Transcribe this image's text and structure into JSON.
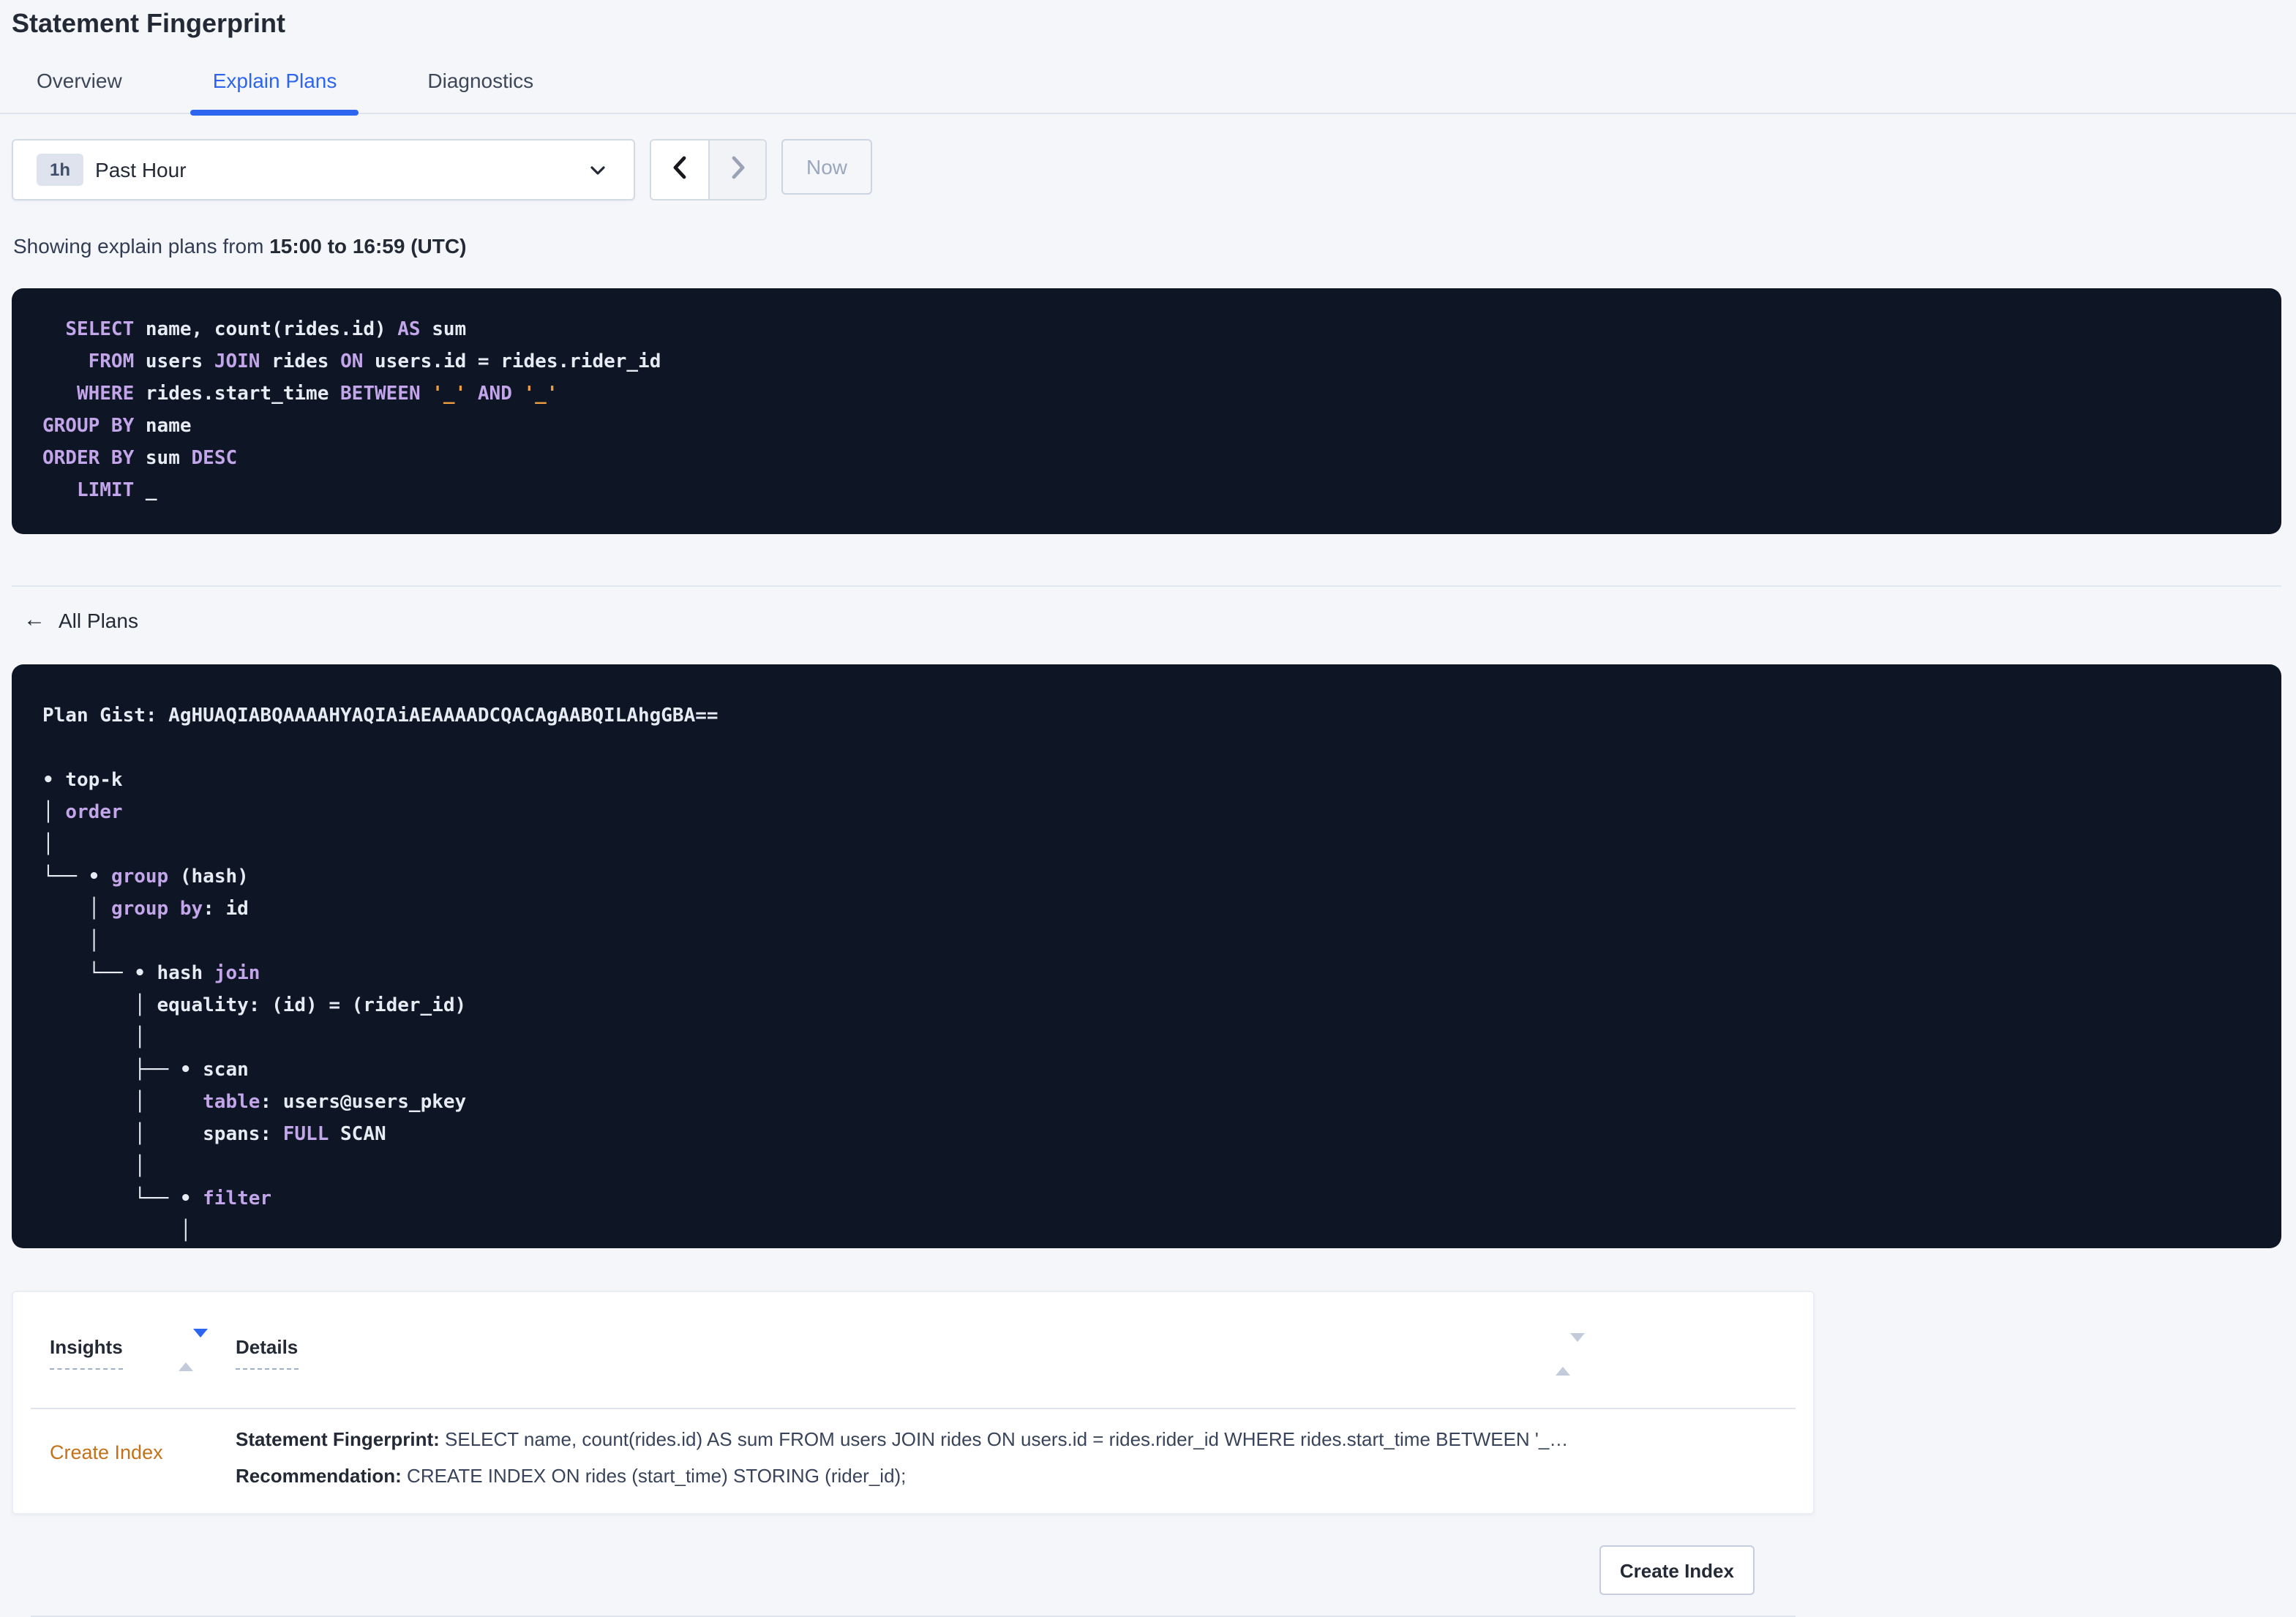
{
  "page": {
    "title": "Statement Fingerprint"
  },
  "tabs": {
    "items": [
      {
        "label": "Overview",
        "active": false
      },
      {
        "label": "Explain Plans",
        "active": true
      },
      {
        "label": "Diagnostics",
        "active": false
      }
    ]
  },
  "time_picker": {
    "interval_badge": "1h",
    "selected_label": "Past Hour",
    "now_label": "Now",
    "prev_enabled": true,
    "next_enabled": false
  },
  "status_line": {
    "prefix": "Showing explain plans from ",
    "range": "15:00 to 16:59 (UTC)"
  },
  "colors": {
    "accent_blue": "#2d65f1",
    "code_background": "#0e1626",
    "code_plain": "#e7ecf4",
    "code_keyword": "#c3a6ea",
    "code_literal": "#ed9d3f",
    "insight_orange": "#c47217",
    "page_background": "#f5f6fa"
  },
  "sql_statement": {
    "lines": [
      [
        [
          "p",
          "  "
        ],
        [
          "k",
          "SELECT"
        ],
        [
          "p",
          " name, count(rides.id) "
        ],
        [
          "k",
          "AS"
        ],
        [
          "p",
          " sum"
        ]
      ],
      [
        [
          "p",
          "    "
        ],
        [
          "k",
          "FROM"
        ],
        [
          "p",
          " users "
        ],
        [
          "k",
          "JOIN"
        ],
        [
          "p",
          " rides "
        ],
        [
          "k",
          "ON"
        ],
        [
          "p",
          " users.id = rides.rider_id"
        ]
      ],
      [
        [
          "p",
          "   "
        ],
        [
          "k",
          "WHERE"
        ],
        [
          "p",
          " rides.start_time "
        ],
        [
          "k",
          "BETWEEN"
        ],
        [
          "p",
          " "
        ],
        [
          "o",
          "'_'"
        ],
        [
          "p",
          " "
        ],
        [
          "k",
          "AND"
        ],
        [
          "p",
          " "
        ],
        [
          "o",
          "'_'"
        ]
      ],
      [
        [
          "k",
          "GROUP BY"
        ],
        [
          "p",
          " name"
        ]
      ],
      [
        [
          "k",
          "ORDER BY"
        ],
        [
          "p",
          " sum "
        ],
        [
          "k",
          "DESC"
        ]
      ],
      [
        [
          "p",
          "   "
        ],
        [
          "k",
          "LIMIT"
        ],
        [
          "p",
          " _"
        ]
      ]
    ]
  },
  "plans_nav": {
    "back_label": "All Plans",
    "back_icon": "arrow-left"
  },
  "plan_gist": {
    "lines": [
      [
        [
          "p",
          "Plan Gist: AgHUAQIABQAAAAHYAQIAiAEAAAADCQACAgAABQILAhgGBA=="
        ]
      ],
      [],
      [
        [
          "p",
          "• top-k"
        ]
      ],
      [
        [
          "p",
          "│ "
        ],
        [
          "k",
          "order"
        ]
      ],
      [
        [
          "p",
          "│"
        ]
      ],
      [
        [
          "p",
          "└── • "
        ],
        [
          "k",
          "group"
        ],
        [
          "p",
          " (hash)"
        ]
      ],
      [
        [
          "p",
          "    │ "
        ],
        [
          "k",
          "group by"
        ],
        [
          "p",
          ": id"
        ]
      ],
      [
        [
          "p",
          "    │"
        ]
      ],
      [
        [
          "p",
          "    └── • hash "
        ],
        [
          "k",
          "join"
        ]
      ],
      [
        [
          "p",
          "        │ equality: (id) = (rider_id)"
        ]
      ],
      [
        [
          "p",
          "        │"
        ]
      ],
      [
        [
          "p",
          "        ├── • scan"
        ]
      ],
      [
        [
          "p",
          "        │     "
        ],
        [
          "k",
          "table"
        ],
        [
          "p",
          ": users@users_pkey"
        ]
      ],
      [
        [
          "p",
          "        │     spans: "
        ],
        [
          "k",
          "FULL"
        ],
        [
          "p",
          " SCAN"
        ]
      ],
      [
        [
          "p",
          "        │"
        ]
      ],
      [
        [
          "p",
          "        └── • "
        ],
        [
          "k",
          "filter"
        ]
      ],
      [
        [
          "p",
          "            │"
        ]
      ]
    ]
  },
  "insights_table": {
    "columns": [
      {
        "label": "Insights",
        "sort": "desc"
      },
      {
        "label": "Details",
        "sort": "none"
      }
    ],
    "rows": [
      {
        "insight": "Create Index",
        "fingerprint_label": "Statement Fingerprint:",
        "fingerprint_value": " SELECT name, count(rides.id) AS sum FROM users JOIN rides ON users.id = rides.rider_id WHERE rides.start_time BETWEEN '_…",
        "recommendation_label": "Recommendation:",
        "recommendation_value": " CREATE INDEX ON rides (start_time) STORING (rider_id);",
        "action_label": "Create Index"
      }
    ]
  }
}
